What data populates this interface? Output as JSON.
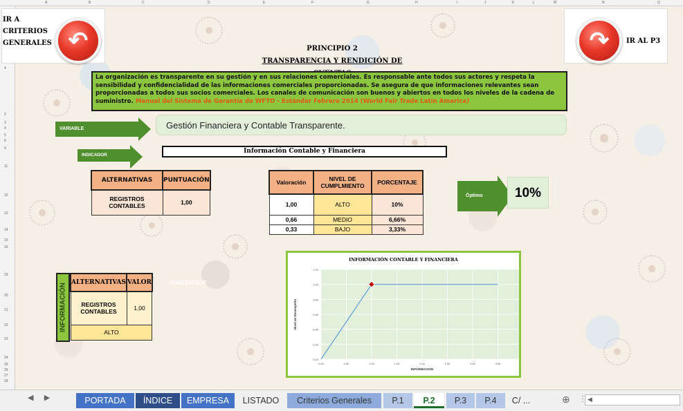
{
  "nav": {
    "left_label": "IR A CRITERIOS GENERALES",
    "right_label": "IR AL P3"
  },
  "title": {
    "line1": "PRINCIPIO 2",
    "line2": "TRANSPARENCIA Y RENDICIÓN DE CUENTAS"
  },
  "description": {
    "text": "La organización es transparente en su gestión y en sus relaciones comerciales. Es responsable ante todos sus actores y respeta la sensibilidad y confidencialidad de las informaciones comerciales proporcionadas. Se asegura de que informaciones relevantes sean proporcionadas a todos sus socios comerciales. Los canales de comunicación son buenos y abiertos en todos los niveles de la cadena de suministro.",
    "source": "Manual del Sistema de Garantía de WFTO - Estándar Febrero 2014 (World Fair Trade Latin America)"
  },
  "variable": {
    "tag": "VARIABLE",
    "value": "Gestión Financiera y Contable Transparente."
  },
  "indicator": {
    "tag": "INDICADOR",
    "value": "Información Contable y Financiera"
  },
  "alternatives_table": {
    "headers": [
      "ALTERNATIVAS",
      "PUNTUACIÓN"
    ],
    "rows": [
      [
        "REGISTROS CONTABLES",
        "1,00"
      ]
    ]
  },
  "valuation_table": {
    "headers": [
      "Valoración",
      "NIVEL DE CUMPLMIENTO",
      "PORCENTAJE"
    ],
    "rows": [
      [
        "1,00",
        "ALTO",
        "10%"
      ],
      [
        "0,66",
        "MEDIO",
        "6,66%"
      ],
      [
        "0,33",
        "BAJO",
        "3,33%"
      ]
    ]
  },
  "result": {
    "tag": "Óptimo",
    "percent": "10%"
  },
  "info_block": {
    "vertical_label": "INFORMACIÓN",
    "headers": [
      "ALTERNATIVAS",
      "VALOR"
    ],
    "row": [
      "REGISTROS CONTABLES",
      "1,00"
    ],
    "level": "ALTO",
    "hidden_label": "PORCENTAJE"
  },
  "chart_data": {
    "type": "line",
    "title": "INFORMACIÓN CONTABLE Y FINANCIERA",
    "xlabel": "INFORMACIÓN",
    "ylabel": "Nivel de Desempeño",
    "x_ticks": [
      "0,00",
      "0,50",
      "1,00",
      "1,50",
      "2,00",
      "2,50",
      "3,00",
      "3,50",
      "4,00"
    ],
    "y_ticks": [
      "0,00",
      "0,20",
      "0,40",
      "0,60",
      "0,80",
      "1,00",
      "1,20"
    ],
    "xlim": [
      0,
      4
    ],
    "ylim": [
      0,
      1.2
    ],
    "series": [
      {
        "x": [
          0,
          1,
          3.5
        ],
        "y": [
          0,
          1,
          1
        ],
        "color": "#5b9bd5"
      }
    ],
    "highlight_point": {
      "x": 1,
      "y": 1,
      "color": "#c00000"
    },
    "background": "#e2efda",
    "grid": true
  },
  "tabs": [
    {
      "label": "PORTADA",
      "color": "#4472c4"
    },
    {
      "label": "ÍNDICE",
      "color": "#2f4d86"
    },
    {
      "label": "EMPRESA",
      "color": "#4472c4"
    },
    {
      "label": "LISTADO",
      "color": ""
    },
    {
      "label": "Criterios Generales",
      "color": "#8eaadb"
    },
    {
      "label": "P.1",
      "color": "#b4c7e7"
    },
    {
      "label": "P.2",
      "color": ""
    },
    {
      "label": "P.3",
      "color": "#b4c7e7"
    },
    {
      "label": "P.4",
      "color": "#b4c7e7"
    },
    {
      "label": "C/ ...",
      "color": ""
    }
  ],
  "active_tab": "P.2",
  "col_headers": [
    "A",
    "B",
    "C",
    "D",
    "E",
    "F",
    "G",
    "H",
    "I",
    "J",
    "K",
    "L",
    "M",
    "N",
    "O"
  ]
}
